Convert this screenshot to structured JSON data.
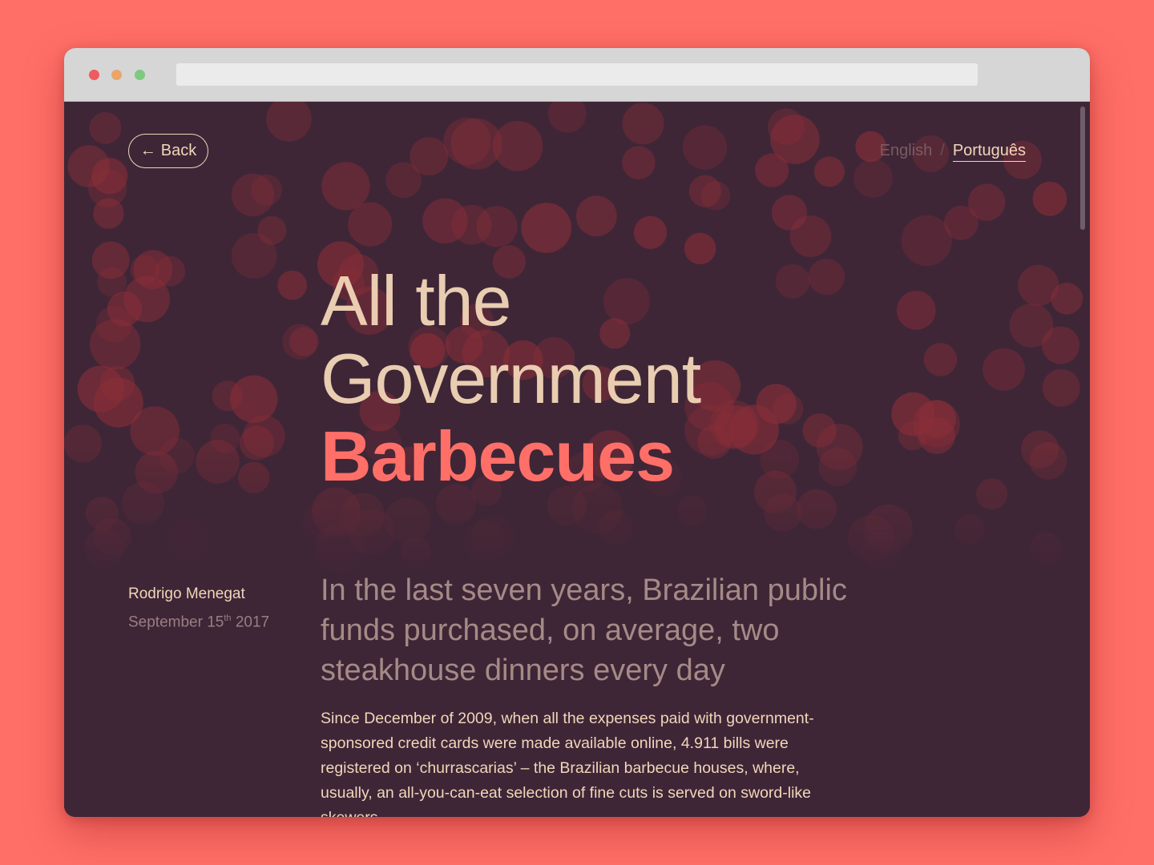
{
  "nav": {
    "back_arrow": "←",
    "back_label": "Back",
    "lang_en": "English",
    "lang_separator": "/",
    "lang_pt": "Português"
  },
  "article": {
    "title_line1": "All the",
    "title_line2": "Government",
    "title_line3": "Barbecues",
    "author": "Rodrigo Menegat",
    "date_prefix": "September 15",
    "date_sup": "th",
    "date_suffix": " 2017",
    "lede": "In the last seven years, Brazilian public funds purchased, on average, two steakhouse dinners every day",
    "body": "Since December of 2009, when all the expenses paid with government-sponsored credit cards were made available online, 4.911 bills were registered on ‘churrascarias’ – the Brazilian barbecue houses, where, usually, an all-you-can-eat selection of fine cuts is served on sword-like skewers."
  },
  "colors": {
    "page_background": "#ff6f68",
    "content_background": "#3e2637",
    "accent": "#ff6f68",
    "text_cream": "#f2d6b8",
    "bokeh": "#8a2e38"
  }
}
